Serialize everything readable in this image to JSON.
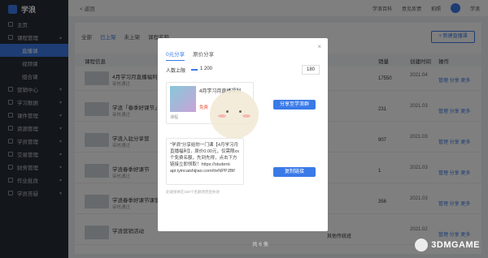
{
  "app": {
    "name": "学浪",
    "back": "< 返回"
  },
  "topbar": {
    "links": [
      "学浪百科",
      "意见反馈",
      "拍照",
      "学浪"
    ]
  },
  "sidebar": {
    "items": [
      {
        "label": "主页",
        "type": "item"
      },
      {
        "label": "课程管理",
        "type": "group",
        "arrow": "^"
      },
      {
        "label": "直播课",
        "type": "sub",
        "active": true
      },
      {
        "label": "视频课",
        "type": "sub"
      },
      {
        "label": "组合课",
        "type": "sub"
      },
      {
        "label": "营销中心",
        "type": "group",
        "arrow": "v"
      },
      {
        "label": "学习数据",
        "type": "group",
        "arrow": "v"
      },
      {
        "label": "课件管理",
        "type": "group",
        "arrow": "v"
      },
      {
        "label": "资源管理",
        "type": "group",
        "arrow": "v"
      },
      {
        "label": "学员管理",
        "type": "group",
        "arrow": "v"
      },
      {
        "label": "交易管理",
        "type": "group",
        "arrow": "v"
      },
      {
        "label": "财务管理",
        "type": "group",
        "arrow": "v"
      },
      {
        "label": "作业批改",
        "type": "group",
        "arrow": "v"
      },
      {
        "label": "学员答疑",
        "type": "group",
        "arrow": "v"
      }
    ]
  },
  "filters": {
    "all": "全部",
    "on": "已上架",
    "off": "未上架",
    "name": "课程名称"
  },
  "new_button": "+ 新建直播课",
  "table": {
    "headers": [
      "课程信息",
      "销量",
      "创建时间",
      "操作"
    ],
    "rows": [
      {
        "title": "4月学习月直播福利",
        "status": "审核通过",
        "sales": "17550",
        "date": "2021.04",
        "ops": "管理 分享 更多"
      },
      {
        "title": "学浪「春季好课节」...",
        "status": "审核通过",
        "sales": "231",
        "date": "2021.03",
        "ops": "管理 分享 更多"
      },
      {
        "title": "学浪入驻分享营",
        "status": "审核通过",
        "sales": "907",
        "date": "2021.03",
        "ops": "管理 分享 更多"
      },
      {
        "title": "学浪春季好课节",
        "status": "审核通过",
        "sales": "1",
        "date": "2021.03",
        "ops": "管理 分享 更多"
      },
      {
        "title": "学浪春季好课节课营...",
        "status": "审核通过",
        "sales": "356",
        "date": "2021.03",
        "ops": "管理 分享 更多"
      },
      {
        "title": "学浪营销活动",
        "status": "",
        "sales": "",
        "date": "2021.02",
        "ops": "管理 分享 更多"
      }
    ],
    "extra_cell": "其他传统班"
  },
  "pager": "共 6 条",
  "modal": {
    "tabs": [
      "0元分享",
      "原价分享"
    ],
    "limit_label": "人数上限",
    "limit_val": "1 200",
    "limit_box": "180",
    "card": {
      "title": "4月学习月直播福利",
      "price": "免费",
      "note": "课程"
    },
    "share_button": "分享至学浪群",
    "link_text": "\"学浪\"分享给你一门课【4月学习月直播福利】，原价0.00元，仅需限xx个免费名额，先到先得，点击下方链接立即领取！https://student-api.iyincaishijiao.com/t/eNPPJBf/",
    "copy_button": "复制链接",
    "hint": "此链接将在180个名额领完后失效"
  },
  "mascot": {
    "label": "口水喵"
  },
  "watermark": {
    "text": "3DMGAME"
  }
}
